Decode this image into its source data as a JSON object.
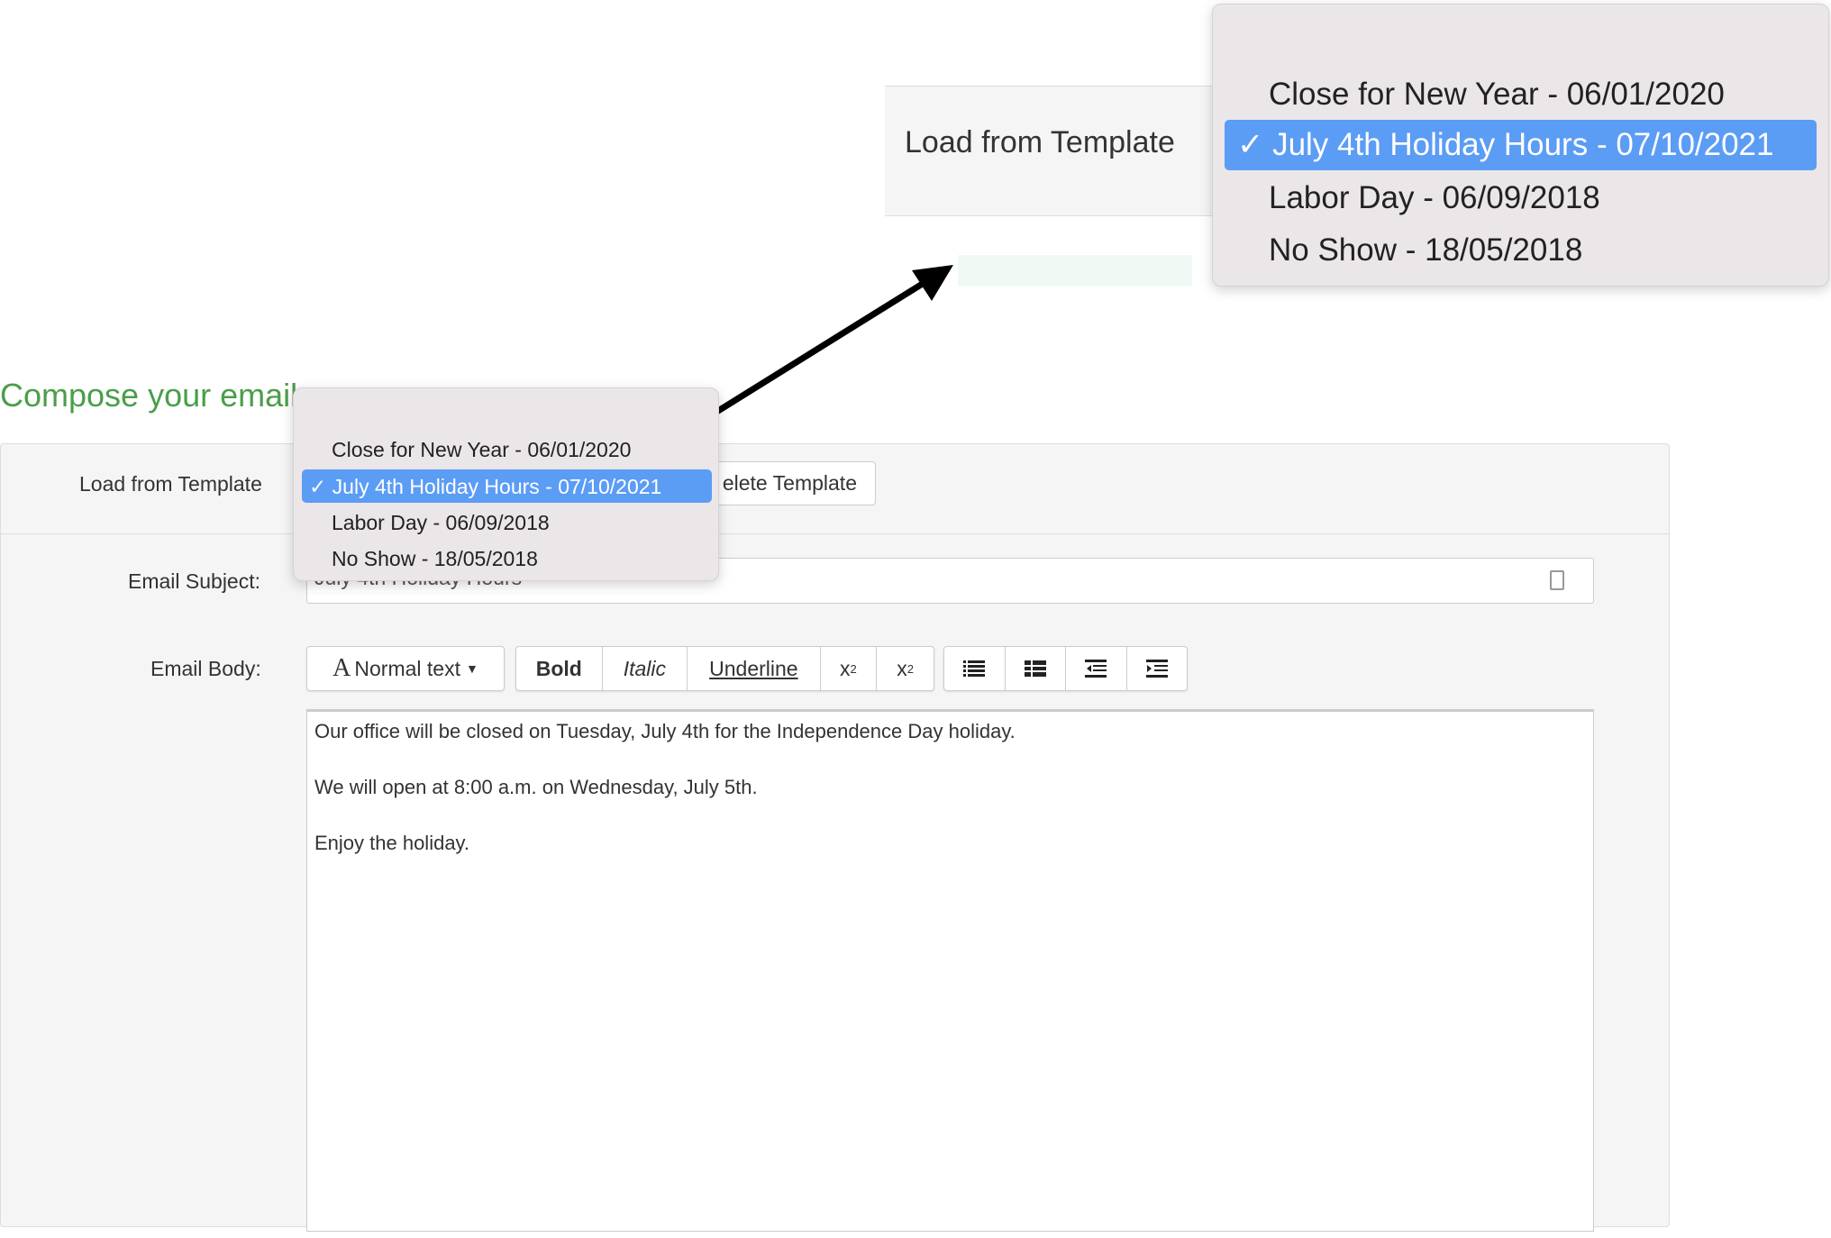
{
  "compose": {
    "title": "Compose your email",
    "load_template_label": "Load from Template",
    "delete_template_label": "elete Template",
    "subject_label": "Email Subject:",
    "subject_value": "July 4th Holiday Hours",
    "body_label": "Email Body:",
    "toolbar": {
      "format_label": "Normal text",
      "bold": "Bold",
      "italic": "Italic",
      "underline": "Underline",
      "subscript": "x",
      "subscript_mark": "2",
      "superscript": "x",
      "superscript_mark": "2"
    },
    "body_lines": [
      "Our office will be closed on Tuesday, July 4th for the Independence Day holiday.",
      "We will open at 8:00 a.m. on Wednesday, July 5th.",
      "Enjoy the holiday."
    ]
  },
  "template_dropdown": {
    "check": "✓",
    "options": [
      "Close for New Year - 06/01/2020",
      "July 4th Holiday Hours - 07/10/2021",
      "Labor Day - 06/09/2018",
      "No Show - 18/05/2018"
    ],
    "selected_index": 1
  },
  "inset": {
    "load_template_label": "Load from Template"
  },
  "colors": {
    "title_green": "#4a9e4a",
    "selection_blue": "#5b9cf5"
  }
}
